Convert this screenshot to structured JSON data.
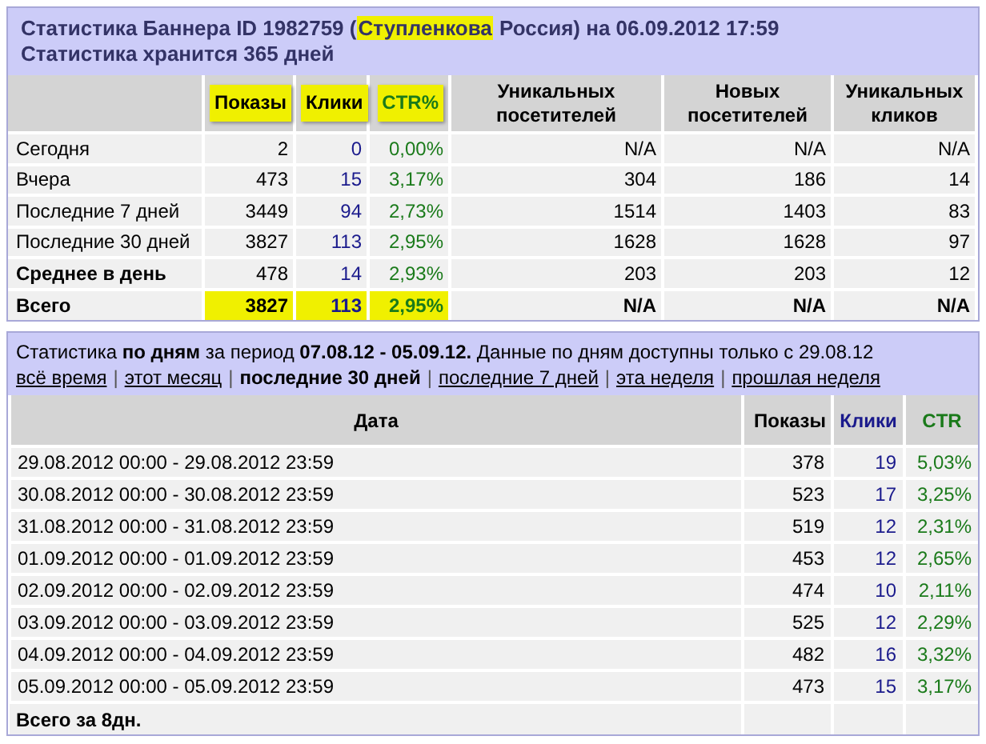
{
  "summary": {
    "title_parts": [
      {
        "text": "Статистика Баннера ID 1982759 (",
        "highlighted": false
      },
      {
        "text": "Ступленкова",
        "highlighted": true
      },
      {
        "text": " Россия) на 06.09.2012 17:59",
        "highlighted": false
      }
    ],
    "subtitle": "Статистика хранится 365 дней",
    "columns": [
      {
        "label": "Показы",
        "kind": "shows",
        "highlighted": true
      },
      {
        "label": "Клики",
        "kind": "clicks",
        "highlighted": true
      },
      {
        "label": "CTR%",
        "kind": "ctr",
        "highlighted": true
      },
      {
        "label": "Уникальных посетителей",
        "kind": "plain",
        "highlighted": false
      },
      {
        "label": "Новых посетителей",
        "kind": "plain",
        "highlighted": false
      },
      {
        "label": "Уникальных кликов",
        "kind": "plain",
        "highlighted": false
      }
    ],
    "rows": [
      {
        "label": "Сегодня",
        "kind": "normal",
        "cells": [
          "2",
          "0",
          "0,00%",
          "N/A",
          "N/A",
          "N/A"
        ]
      },
      {
        "label": "Вчера",
        "kind": "normal",
        "cells": [
          "473",
          "15",
          "3,17%",
          "304",
          "186",
          "14"
        ]
      },
      {
        "label": "Последние 7 дней",
        "kind": "normal",
        "cells": [
          "3449",
          "94",
          "2,73%",
          "1514",
          "1403",
          "83"
        ]
      },
      {
        "label": "Последние 30 дней",
        "kind": "normal",
        "cells": [
          "3827",
          "113",
          "2,95%",
          "1628",
          "1628",
          "97"
        ]
      },
      {
        "label": "Среднее в день",
        "kind": "average",
        "cells": [
          "478",
          "14",
          "2,93%",
          "203",
          "203",
          "12"
        ]
      },
      {
        "label": "Всего",
        "kind": "total",
        "cells": [
          "3827",
          "113",
          "2,95%",
          "N/A",
          "N/A",
          "N/A"
        ]
      }
    ]
  },
  "daily": {
    "intro": "Статистика **по дням** за период **07.08.12 - 05.09.12.** Данные по дням доступны только с 29.08.12",
    "period_separator": "|",
    "periods": [
      {
        "label": "всё время",
        "selected": false
      },
      {
        "label": "этот месяц",
        "selected": false
      },
      {
        "label": "последние 30 дней",
        "selected": true
      },
      {
        "label": "последние 7 дней",
        "selected": false
      },
      {
        "label": "эта неделя",
        "selected": false
      },
      {
        "label": "прошлая неделя",
        "selected": false
      }
    ],
    "columns": [
      {
        "label": "Дата",
        "kind": "date"
      },
      {
        "label": "Показы",
        "kind": "shows"
      },
      {
        "label": "Клики",
        "kind": "clicks"
      },
      {
        "label": "CTR",
        "kind": "ctr"
      }
    ],
    "rows": [
      {
        "date": "29.08.2012 00:00 - 29.08.2012 23:59",
        "shows": "378",
        "clicks": "19",
        "ctr": "5,03%"
      },
      {
        "date": "30.08.2012 00:00 - 30.08.2012 23:59",
        "shows": "523",
        "clicks": "17",
        "ctr": "3,25%"
      },
      {
        "date": "31.08.2012 00:00 - 31.08.2012 23:59",
        "shows": "519",
        "clicks": "12",
        "ctr": "2,31%"
      },
      {
        "date": "01.09.2012 00:00 - 01.09.2012 23:59",
        "shows": "453",
        "clicks": "12",
        "ctr": "2,65%"
      },
      {
        "date": "02.09.2012 00:00 - 02.09.2012 23:59",
        "shows": "474",
        "clicks": "10",
        "ctr": "2,11%"
      },
      {
        "date": "03.09.2012 00:00 - 03.09.2012 23:59",
        "shows": "525",
        "clicks": "12",
        "ctr": "2,29%"
      },
      {
        "date": "04.09.2012 00:00 - 04.09.2012 23:59",
        "shows": "482",
        "clicks": "16",
        "ctr": "3,32%"
      },
      {
        "date": "05.09.2012 00:00 - 05.09.2012 23:59",
        "shows": "473",
        "clicks": "15",
        "ctr": "3,17%"
      }
    ],
    "total_label": "Всего за 8дн."
  }
}
